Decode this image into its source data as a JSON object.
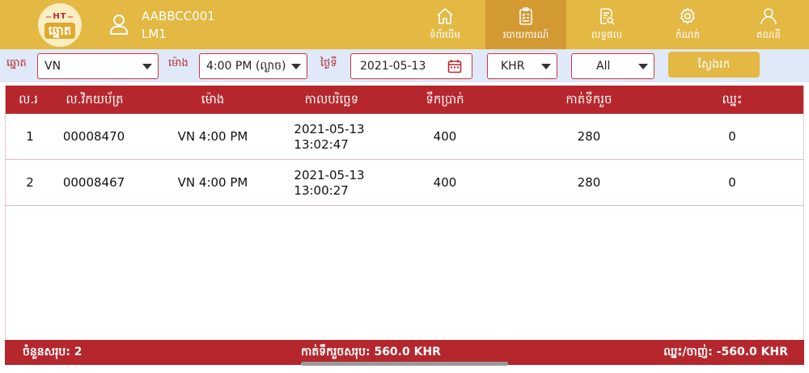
{
  "header": {
    "logo_top": "HT",
    "logo_main": "ឆ្នោត",
    "username": "AABBCC001",
    "level": "LM1",
    "nav": [
      {
        "label": "ទំព័រដើម",
        "icon": "home-icon",
        "active": false
      },
      {
        "label": "របាយការណ៍",
        "icon": "report-icon",
        "active": true
      },
      {
        "label": "លទ្ធផល",
        "icon": "result-icon",
        "active": false
      },
      {
        "label": "កំណត់",
        "icon": "gear-icon",
        "active": false
      },
      {
        "label": "គណនី",
        "icon": "account-icon",
        "active": false
      }
    ]
  },
  "filters": {
    "lottery_label": "ឆ្នោត",
    "lottery_value": "VN",
    "time_label": "ម៉ោង",
    "time_value": "4:00 PM (ល្ងាច)",
    "date_label": "ថ្ងៃទី",
    "date_value": "2021-05-13",
    "currency_value": "KHR",
    "status_value": "All",
    "search_label": "ស្វែងរក"
  },
  "table": {
    "columns": [
      "ល.រ",
      "ល.វិកយប័ត្រ",
      "ម៉ោង",
      "កាលបរិច្ឆេទ",
      "ទឹកប្រាក់",
      "កាត់ទឹករួច",
      "ឈ្នះ"
    ],
    "rows": [
      {
        "no": "1",
        "invoice": "00008470",
        "time": "VN 4:00 PM",
        "date": "2021-05-13",
        "clock": "13:02:47",
        "amount": "400",
        "net": "280",
        "win": "0"
      },
      {
        "no": "2",
        "invoice": "00008467",
        "time": "VN 4:00 PM",
        "date": "2021-05-13",
        "clock": "13:00:27",
        "amount": "400",
        "net": "280",
        "win": "0"
      }
    ]
  },
  "footer": {
    "total_count": "ចំនួនសរុប: 2",
    "total_net": "កាត់ទឹករួចសរុប: 560.0 KHR",
    "win_lose": "ឈ្នះ/ចាញ់: -560.0 KHR"
  },
  "colors": {
    "header": "#e3b843",
    "active_tab": "#d39a34",
    "table_header": "#b5272d",
    "filter_bar": "#dfe9f8"
  }
}
